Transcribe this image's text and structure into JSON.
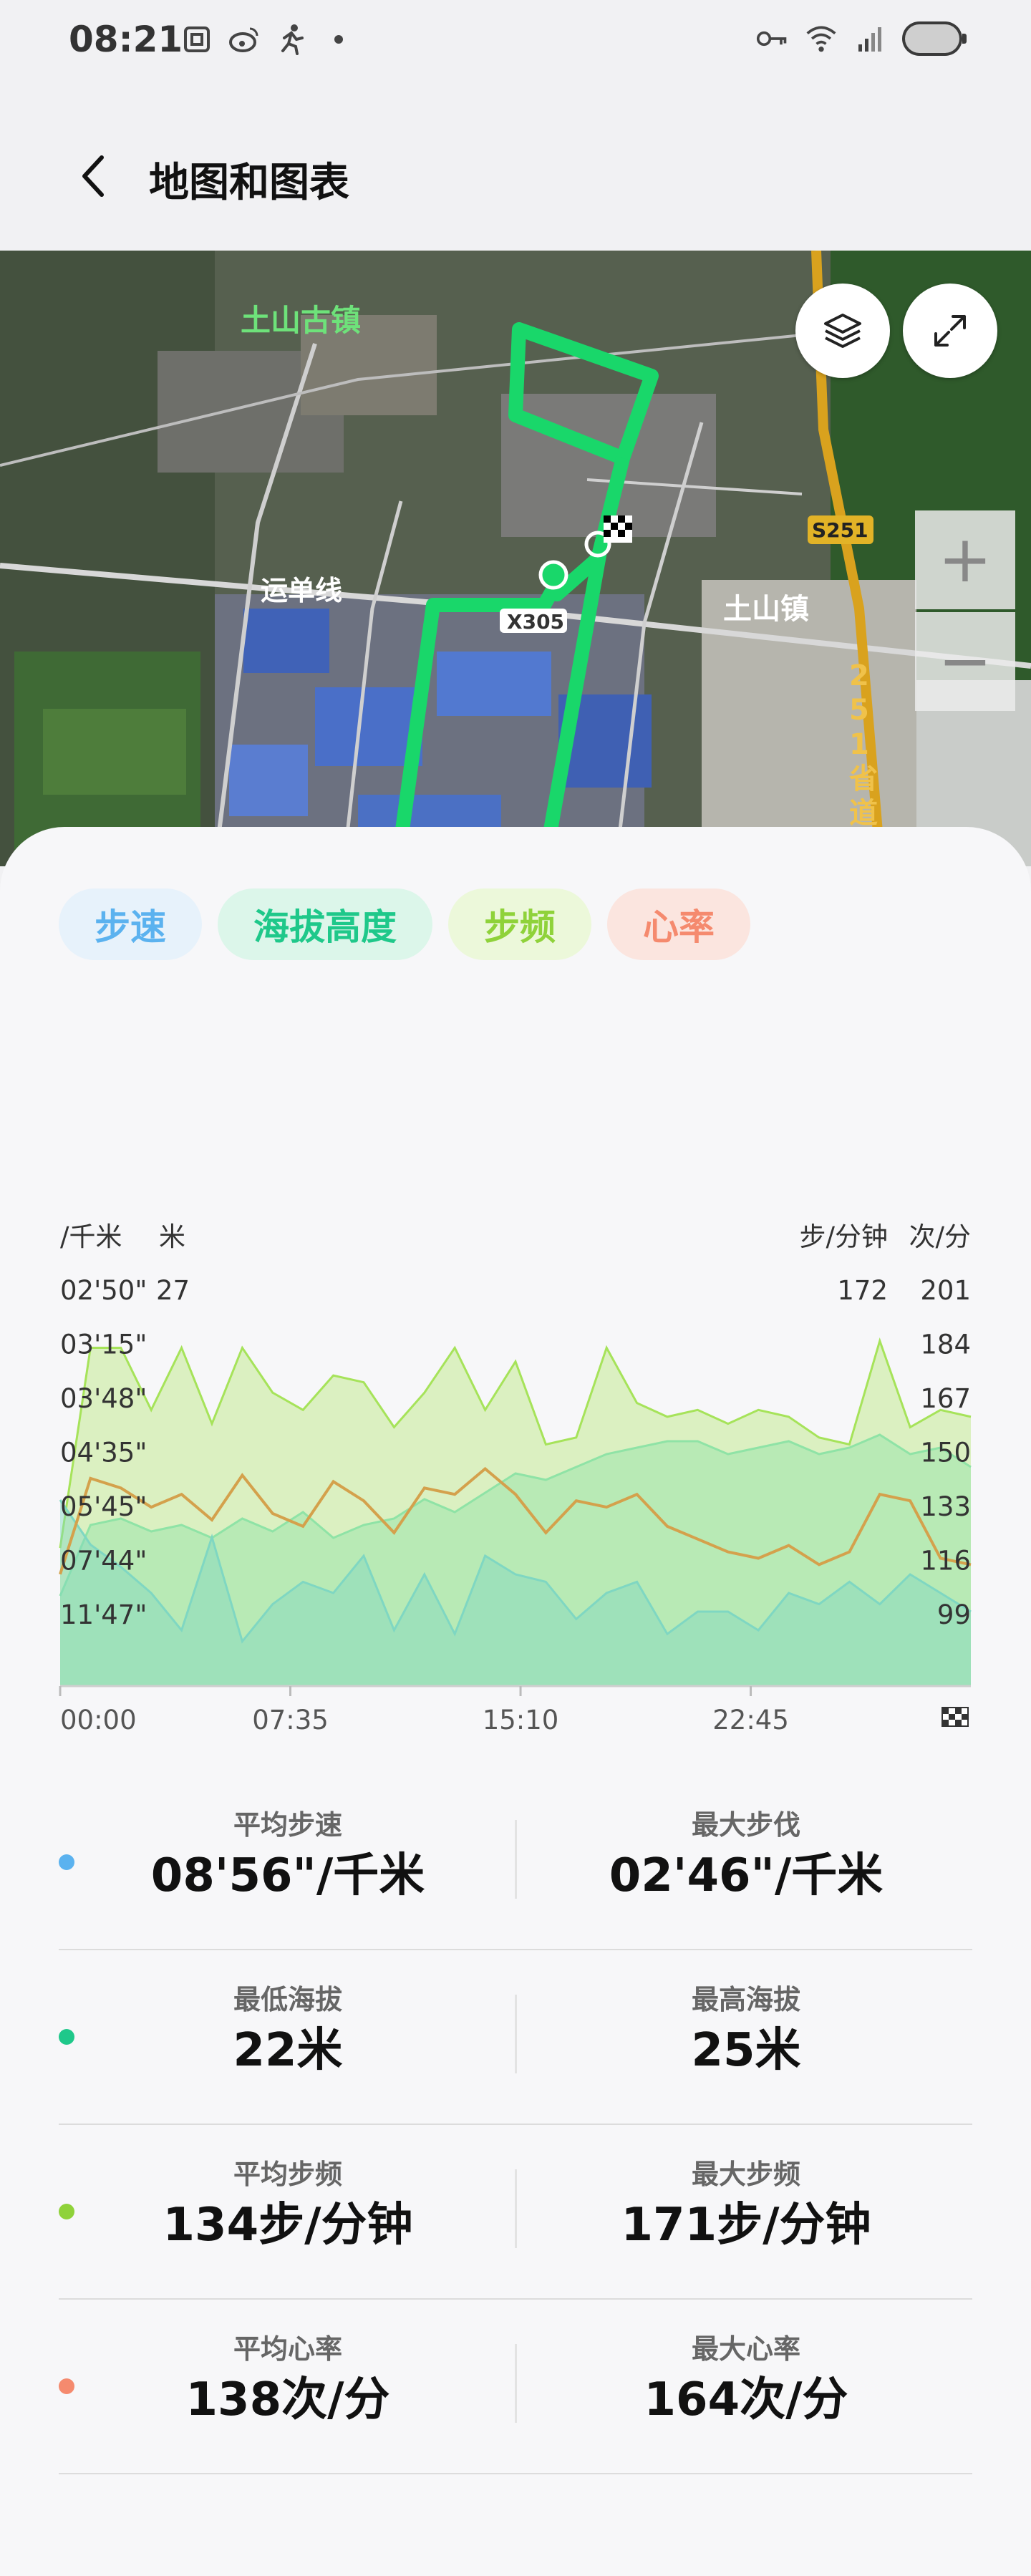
{
  "status_bar": {
    "time": "08:21"
  },
  "header": {
    "title": "地图和图表"
  },
  "map": {
    "labels": {
      "town_a": "土山古镇",
      "road_a": "运单线",
      "road_b": "X305",
      "road_c": "S251",
      "town_b": "土山镇",
      "road_d": "251省道"
    },
    "zoom_in": "+",
    "zoom_out": "−"
  },
  "tabs": [
    {
      "label": "步速",
      "color": "#5bb2ef",
      "bg": "#e7f2fb"
    },
    {
      "label": "海拔高度",
      "color": "#1fc88a",
      "bg": "#dcf6ea"
    },
    {
      "label": "步频",
      "color": "#8fd23a",
      "bg": "#ecf8da"
    },
    {
      "label": "心率",
      "color": "#f58a6e",
      "bg": "#fbe5df"
    }
  ],
  "chart_data": {
    "type": "area",
    "left_units": {
      "pace": "/千米",
      "altitude": "米"
    },
    "right_units": {
      "cadence": "步/分钟",
      "heart_rate": "次/分"
    },
    "pace_ticks": [
      "02'50\"",
      "03'15\"",
      "03'48\"",
      "04'35\"",
      "05'45\"",
      "07'44\"",
      "11'47\""
    ],
    "altitude_ticks": [
      "27"
    ],
    "cadence_ticks": [
      "172"
    ],
    "heart_rate_ticks": [
      "201",
      "184",
      "167",
      "150",
      "133",
      "116",
      "99"
    ],
    "x_ticks": [
      "00:00",
      "07:35",
      "15:10",
      "22:45"
    ],
    "x_range_min": [
      0,
      30
    ],
    "series": [
      {
        "name": "步速",
        "color": "#7fd7c2",
        "x": [
          0,
          1,
          2,
          3,
          4,
          5,
          6,
          7,
          8,
          9,
          10,
          11,
          12,
          13,
          14,
          15,
          16,
          17,
          18,
          19,
          20,
          21,
          22,
          23,
          24,
          25,
          26,
          27,
          28,
          29,
          30
        ],
        "values": [
          0.5,
          0.38,
          0.32,
          0.25,
          0.15,
          0.4,
          0.12,
          0.22,
          0.28,
          0.25,
          0.35,
          0.15,
          0.3,
          0.14,
          0.35,
          0.3,
          0.28,
          0.18,
          0.25,
          0.28,
          0.14,
          0.2,
          0.2,
          0.15,
          0.25,
          0.22,
          0.28,
          0.22,
          0.3,
          0.25,
          0.2
        ]
      },
      {
        "name": "海拔高度",
        "color": "#8fe3a6",
        "x": [
          0,
          1,
          2,
          3,
          4,
          5,
          6,
          7,
          8,
          9,
          10,
          11,
          12,
          13,
          14,
          15,
          16,
          17,
          18,
          19,
          20,
          21,
          22,
          23,
          24,
          25,
          26,
          27,
          28,
          29,
          30
        ],
        "values": [
          22.4,
          23.5,
          23.6,
          23.4,
          23.5,
          23.3,
          23.6,
          23.4,
          23.7,
          23.3,
          23.5,
          23.6,
          23.9,
          23.7,
          24.0,
          24.3,
          24.2,
          24.4,
          24.6,
          24.7,
          24.8,
          24.8,
          24.6,
          24.7,
          24.8,
          24.6,
          24.7,
          24.9,
          24.6,
          24.7,
          24.4
        ]
      },
      {
        "name": "步频",
        "color": "#a6e35a",
        "x": [
          0,
          1,
          2,
          3,
          4,
          5,
          6,
          7,
          8,
          9,
          10,
          11,
          12,
          13,
          14,
          15,
          16,
          17,
          18,
          19,
          20,
          21,
          22,
          23,
          24,
          25,
          26,
          27,
          28,
          29,
          30
        ],
        "values": [
          100,
          158,
          158,
          140,
          158,
          136,
          158,
          145,
          140,
          150,
          148,
          135,
          145,
          158,
          140,
          154,
          130,
          132,
          158,
          142,
          138,
          140,
          136,
          140,
          138,
          132,
          130,
          160,
          135,
          140,
          138
        ]
      },
      {
        "name": "心率",
        "color": "#d4a14c",
        "x": [
          0,
          1,
          2,
          3,
          4,
          5,
          6,
          7,
          8,
          9,
          10,
          11,
          12,
          13,
          14,
          15,
          16,
          17,
          18,
          19,
          20,
          21,
          22,
          23,
          24,
          25,
          26,
          27,
          28,
          29,
          30
        ],
        "values": [
          115,
          145,
          142,
          136,
          140,
          132,
          146,
          134,
          130,
          144,
          138,
          128,
          142,
          140,
          148,
          140,
          128,
          138,
          136,
          140,
          130,
          126,
          122,
          120,
          124,
          118,
          122,
          140,
          138,
          120,
          118
        ]
      }
    ]
  },
  "stats": [
    {
      "color": "#5bb2ef",
      "left": {
        "label": "平均步速",
        "value": "08'56\"/千米"
      },
      "right": {
        "label": "最大步伐",
        "value": "02'46\"/千米"
      }
    },
    {
      "color": "#1fc88a",
      "left": {
        "label": "最低海拔",
        "value": "22米"
      },
      "right": {
        "label": "最高海拔",
        "value": "25米"
      }
    },
    {
      "color": "#8fd23a",
      "left": {
        "label": "平均步频",
        "value": "134步/分钟"
      },
      "right": {
        "label": "最大步频",
        "value": "171步/分钟"
      }
    },
    {
      "color": "#f58a6e",
      "left": {
        "label": "平均心率",
        "value": "138次/分"
      },
      "right": {
        "label": "最大心率",
        "value": "164次/分"
      }
    }
  ]
}
